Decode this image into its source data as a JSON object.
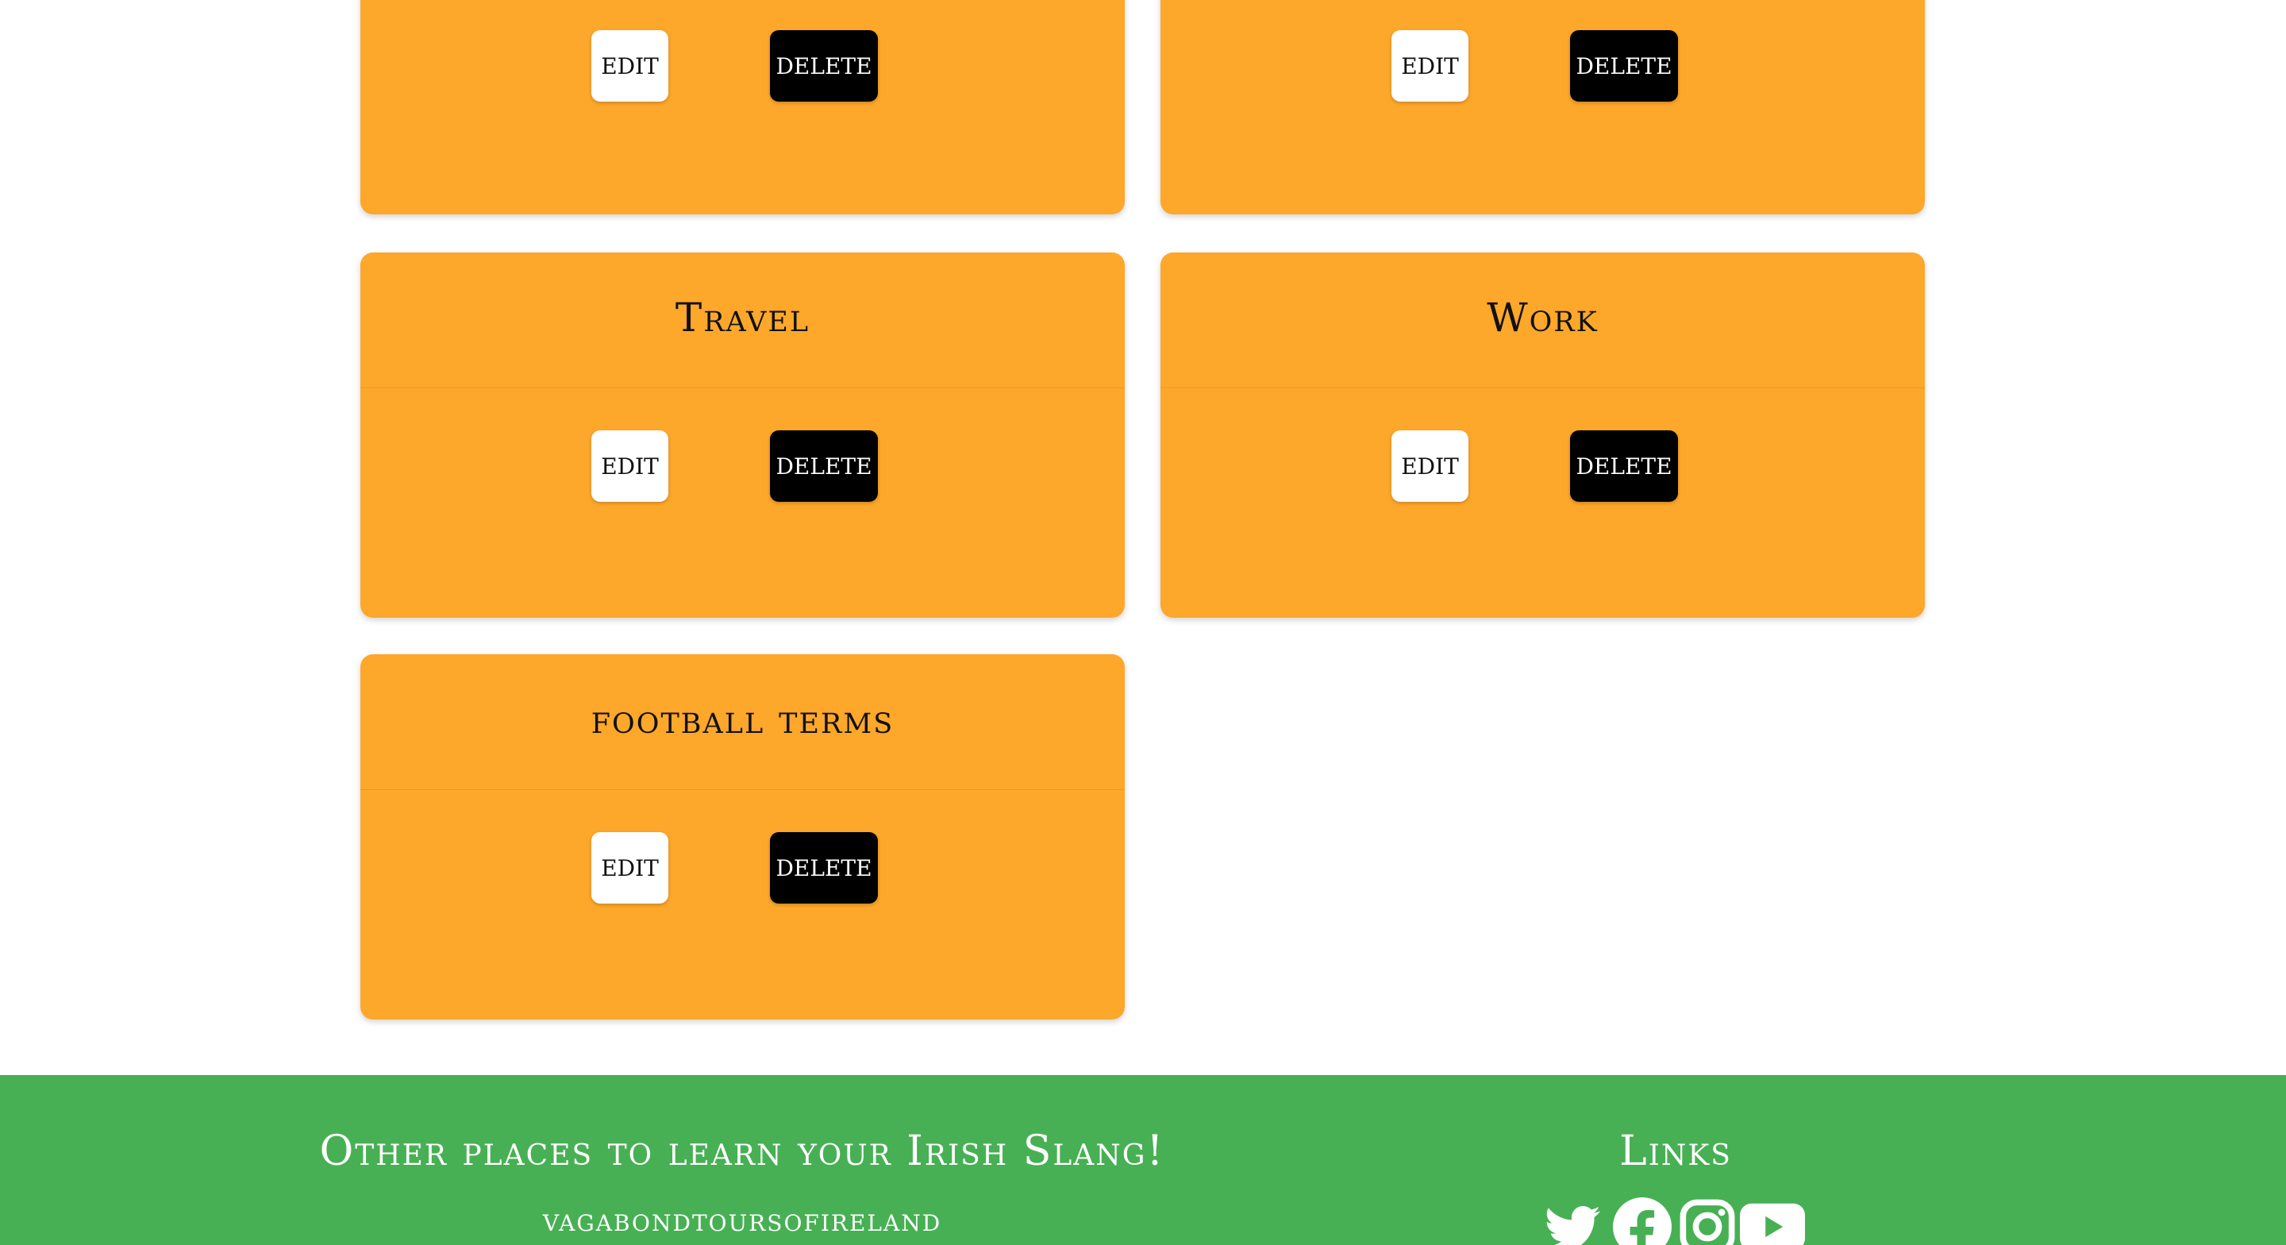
{
  "cards": [
    {
      "title": "",
      "edit_label": "EDIT",
      "delete_label": "DELETE"
    },
    {
      "title": "",
      "edit_label": "EDIT",
      "delete_label": "DELETE"
    },
    {
      "title": "Travel",
      "edit_label": "EDIT",
      "delete_label": "DELETE"
    },
    {
      "title": "Work",
      "edit_label": "EDIT",
      "delete_label": "DELETE"
    },
    {
      "title": "football terms",
      "edit_label": "EDIT",
      "delete_label": "DELETE"
    }
  ],
  "footer": {
    "other_places_heading": "Other places to learn your Irish Slang!",
    "link_vagabond": "vagabondtoursofireland",
    "links_heading": "Links",
    "social_icons": [
      "twitter-icon",
      "facebook-icon",
      "instagram-icon",
      "youtube-icon"
    ]
  },
  "colors": {
    "card_background": "#fda72b",
    "footer_background": "#48b054",
    "edit_button": "#ffffff",
    "delete_button": "#000000"
  }
}
